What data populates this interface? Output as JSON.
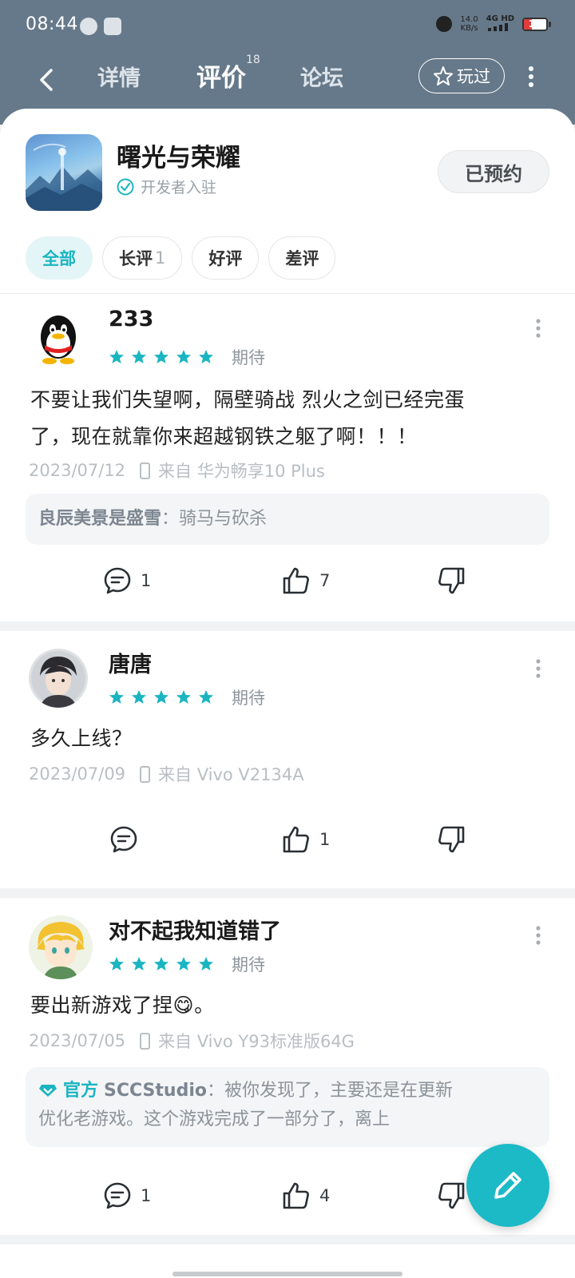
{
  "status_bar": {
    "time": "08:44",
    "net_speed_value": "14.0",
    "net_speed_unit": "KB/s",
    "network": "4G HD",
    "battery": "15",
    "battery_color": "#e23c3c"
  },
  "nav": {
    "tabs": [
      {
        "label": "详情"
      },
      {
        "label": "评价",
        "badge": "18"
      },
      {
        "label": "论坛"
      }
    ],
    "played_label": "玩过"
  },
  "app": {
    "name": "曙光与荣耀",
    "developer_tag": "开发者入驻",
    "reserve_label": "已预约"
  },
  "filters": [
    {
      "label": "全部"
    },
    {
      "label": "长评",
      "count": "1"
    },
    {
      "label": "好评"
    },
    {
      "label": "差评"
    }
  ],
  "accent_color": "#1bb5c1",
  "reviews": [
    {
      "username": "233",
      "rating": 5,
      "tag": "期待",
      "text_line1": "不要让我们失望啊，隔壁骑战 烈火之剑已经完蛋",
      "text_line2": "了，现在就靠你来超越钢铁之躯了啊！！！",
      "date": "2023/07/12",
      "device": "来自 华为畅享10 Plus",
      "reply_author": "良辰美景是盛雪",
      "reply_text": "：骑马与砍杀",
      "comments": "1",
      "likes": "7"
    },
    {
      "username": "唐唐",
      "rating": 5,
      "tag": "期待",
      "text_line1": "多久上线？",
      "date": "2023/07/09",
      "device": "来自 Vivo V2134A",
      "comments": "",
      "likes": "1"
    },
    {
      "username": "对不起我知道错了",
      "rating": 5,
      "tag": "期待",
      "text_line1": "要出新游戏了捏😋。",
      "date": "2023/07/05",
      "device": "来自 Vivo Y93标准版64G",
      "reply_official_label": "官方",
      "reply_author": "SCCStudio",
      "reply_line1": "：被你发现了，主要还是在更新",
      "reply_line2": "优化老游戏。这个游戏完成了一部分了，离上",
      "comments": "1",
      "likes": "4"
    }
  ]
}
